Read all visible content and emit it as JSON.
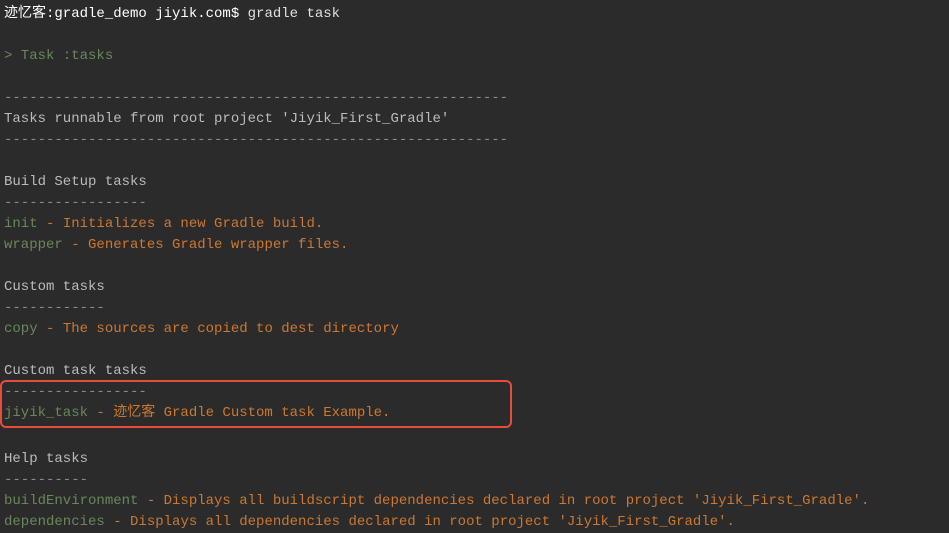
{
  "prompt": {
    "user": "迹忆客:gradle_demo jiyik.com",
    "dollar": "$",
    "command": "gradle task"
  },
  "output": {
    "task_line": "> Task :tasks",
    "dashes_long": "------------------------------------------------------------",
    "tasks_runnable": "Tasks runnable from root project 'Jiyik_First_Gradle'",
    "build_setup": {
      "title": "Build Setup tasks",
      "dashes": "-----------------",
      "init": {
        "name": "init",
        "desc": " - Initializes a new Gradle build."
      },
      "wrapper": {
        "name": "wrapper",
        "desc": " - Generates Gradle wrapper files."
      }
    },
    "custom_tasks": {
      "title": "Custom tasks",
      "dashes": "------------",
      "copy": {
        "name": "copy",
        "desc": " - The sources are copied to dest directory"
      }
    },
    "custom_task_tasks": {
      "title": "Custom task tasks",
      "dashes": "-----------------",
      "jiyik": {
        "name": "jiyik_task",
        "desc": " - 迹忆客 Gradle Custom task Example.              "
      }
    },
    "help_tasks": {
      "title": "Help tasks",
      "dashes": "----------",
      "build_env": {
        "name": "buildEnvironment",
        "desc": " - Displays all buildscript dependencies declared in root project 'Jiyik_First_Gradle'."
      },
      "dependencies": {
        "name": "dependencies",
        "desc": " - Displays all dependencies declared in root project 'Jiyik_First_Gradle'."
      }
    }
  }
}
